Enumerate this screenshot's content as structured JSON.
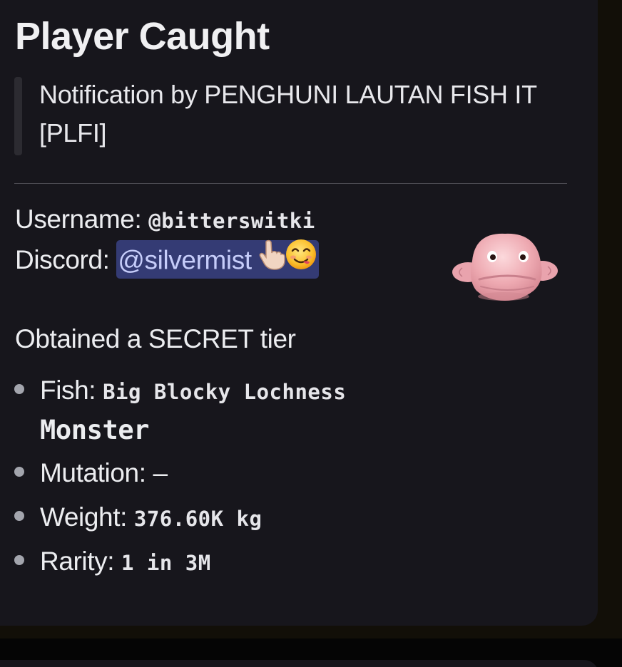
{
  "embed": {
    "title": "Player Caught",
    "quote_line1": "Notification by PENGHUNI LAUTAN FISH IT",
    "quote_line2": "[PLFI]",
    "username_label": "Username:",
    "username_value": "@bitterswitki",
    "discord_label": "Discord:",
    "discord_mention": "@silvermist",
    "obtained_text": "Obtained a SECRET tier",
    "fields": [
      {
        "label": "Fish:",
        "value_line1": "Big Blocky Lochness",
        "value_line2": "Monster"
      },
      {
        "label": "Mutation:",
        "value": "–"
      },
      {
        "label": "Weight:",
        "value": "376.60K kg"
      },
      {
        "label": "Rarity:",
        "value": "1 in 3M"
      }
    ],
    "thumbnail_icon": "blobfish-icon"
  },
  "colors": {
    "embed_bg": "#17161c",
    "page_bg": "#120f08",
    "mention_bg": "#343b74",
    "mention_text": "#c6cdfa",
    "quote_bar": "#2c2b31"
  }
}
